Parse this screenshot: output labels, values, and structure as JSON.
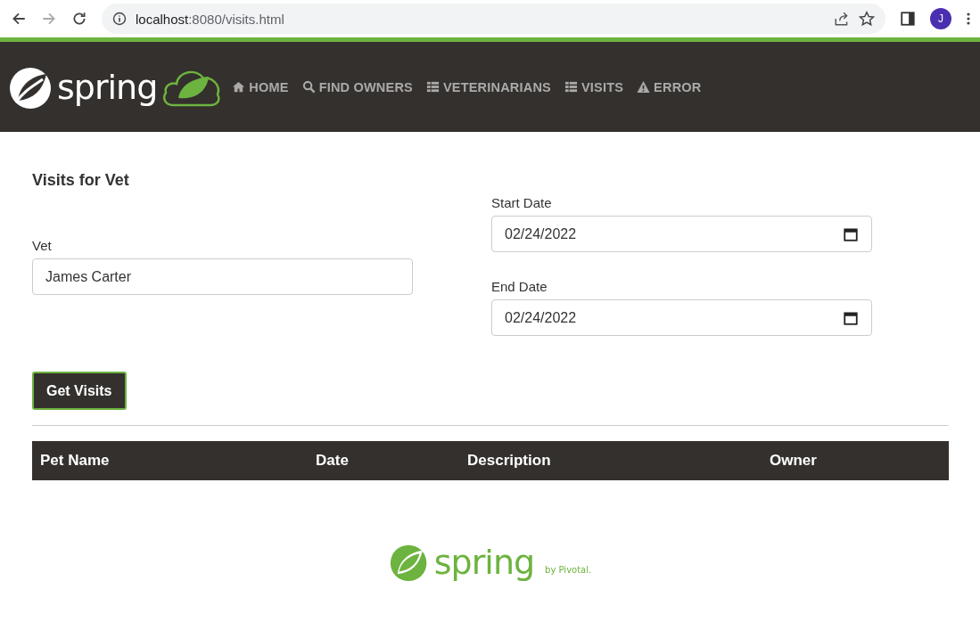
{
  "browser": {
    "url_host": "localhost",
    "url_rest": ":8080/visits.html",
    "profile_initial": "J"
  },
  "navbar": {
    "brand": "spring",
    "items": [
      {
        "label": "HOME"
      },
      {
        "label": "FIND OWNERS"
      },
      {
        "label": "VETERINARIANS"
      },
      {
        "label": "VISITS"
      },
      {
        "label": "ERROR"
      }
    ]
  },
  "heading": "Visits for Vet",
  "form": {
    "vet": {
      "label": "Vet",
      "value": "James Carter"
    },
    "start_date": {
      "label": "Start Date",
      "value": "02/24/2022"
    },
    "end_date": {
      "label": "End Date",
      "value": "02/24/2022"
    },
    "submit": "Get Visits"
  },
  "table": {
    "columns": [
      "Pet Name",
      "Date",
      "Description",
      "Owner"
    ]
  },
  "footer": {
    "brand": "spring",
    "byline": "by Pivotal."
  }
}
